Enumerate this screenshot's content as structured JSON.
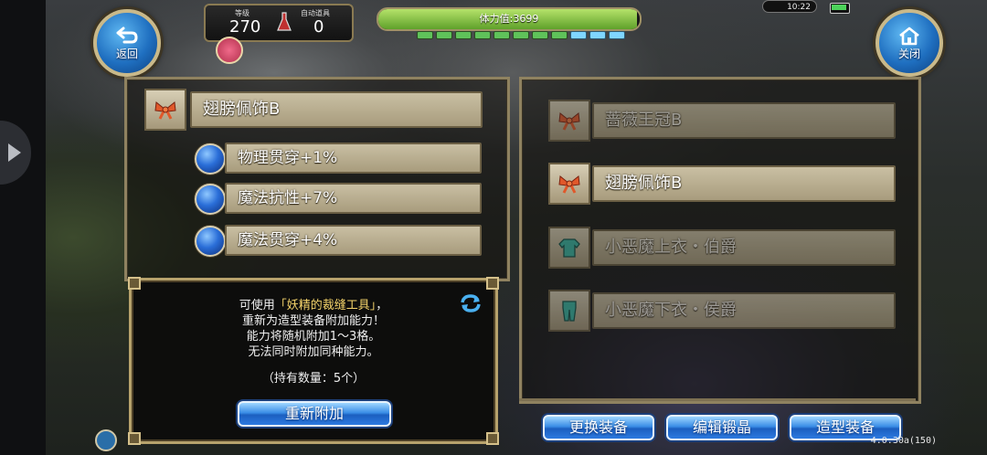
{
  "hud": {
    "back_label": "返回",
    "close_label": "关闭",
    "level_caption": "等级",
    "level_value": "270",
    "auto_item_caption": "自动道具",
    "auto_item_value": "0",
    "stamina_text": "体力值:3699",
    "stamina_fraction": 0.99,
    "stamina_segments": 11,
    "clock": "10:22",
    "version": "4.0.30a(150)"
  },
  "left_panel": {
    "item_name": "翅膀佩饰B",
    "abilities": [
      "物理贯穿+1%",
      "魔法抗性+7%",
      "魔法贯穿+4%"
    ]
  },
  "info": {
    "line1_prefix": "可使用",
    "line1_highlight": "「妖精的裁缝工具」",
    "line1_suffix": "，",
    "line2": "重新为造型装备附加能力！",
    "line3": "能力将随机附加1～3格。",
    "line4": "无法同时附加同种能力。",
    "count_line": "（持有数量：5个）",
    "reattach_button": "重新附加"
  },
  "right_panel": {
    "items": [
      {
        "label": "蔷薇王冠B",
        "icon": "bow-icon",
        "dim": true
      },
      {
        "label": "翅膀佩饰B",
        "icon": "bow-icon",
        "dim": false
      },
      {
        "label": "小恶魔上衣・伯爵",
        "icon": "armor-icon",
        "dim": true
      },
      {
        "label": "小恶魔下衣・侯爵",
        "icon": "armor-icon",
        "dim": true
      }
    ]
  },
  "bottom_buttons": {
    "change": "更换装备",
    "edit": "编辑锻晶",
    "style": "造型装备"
  }
}
